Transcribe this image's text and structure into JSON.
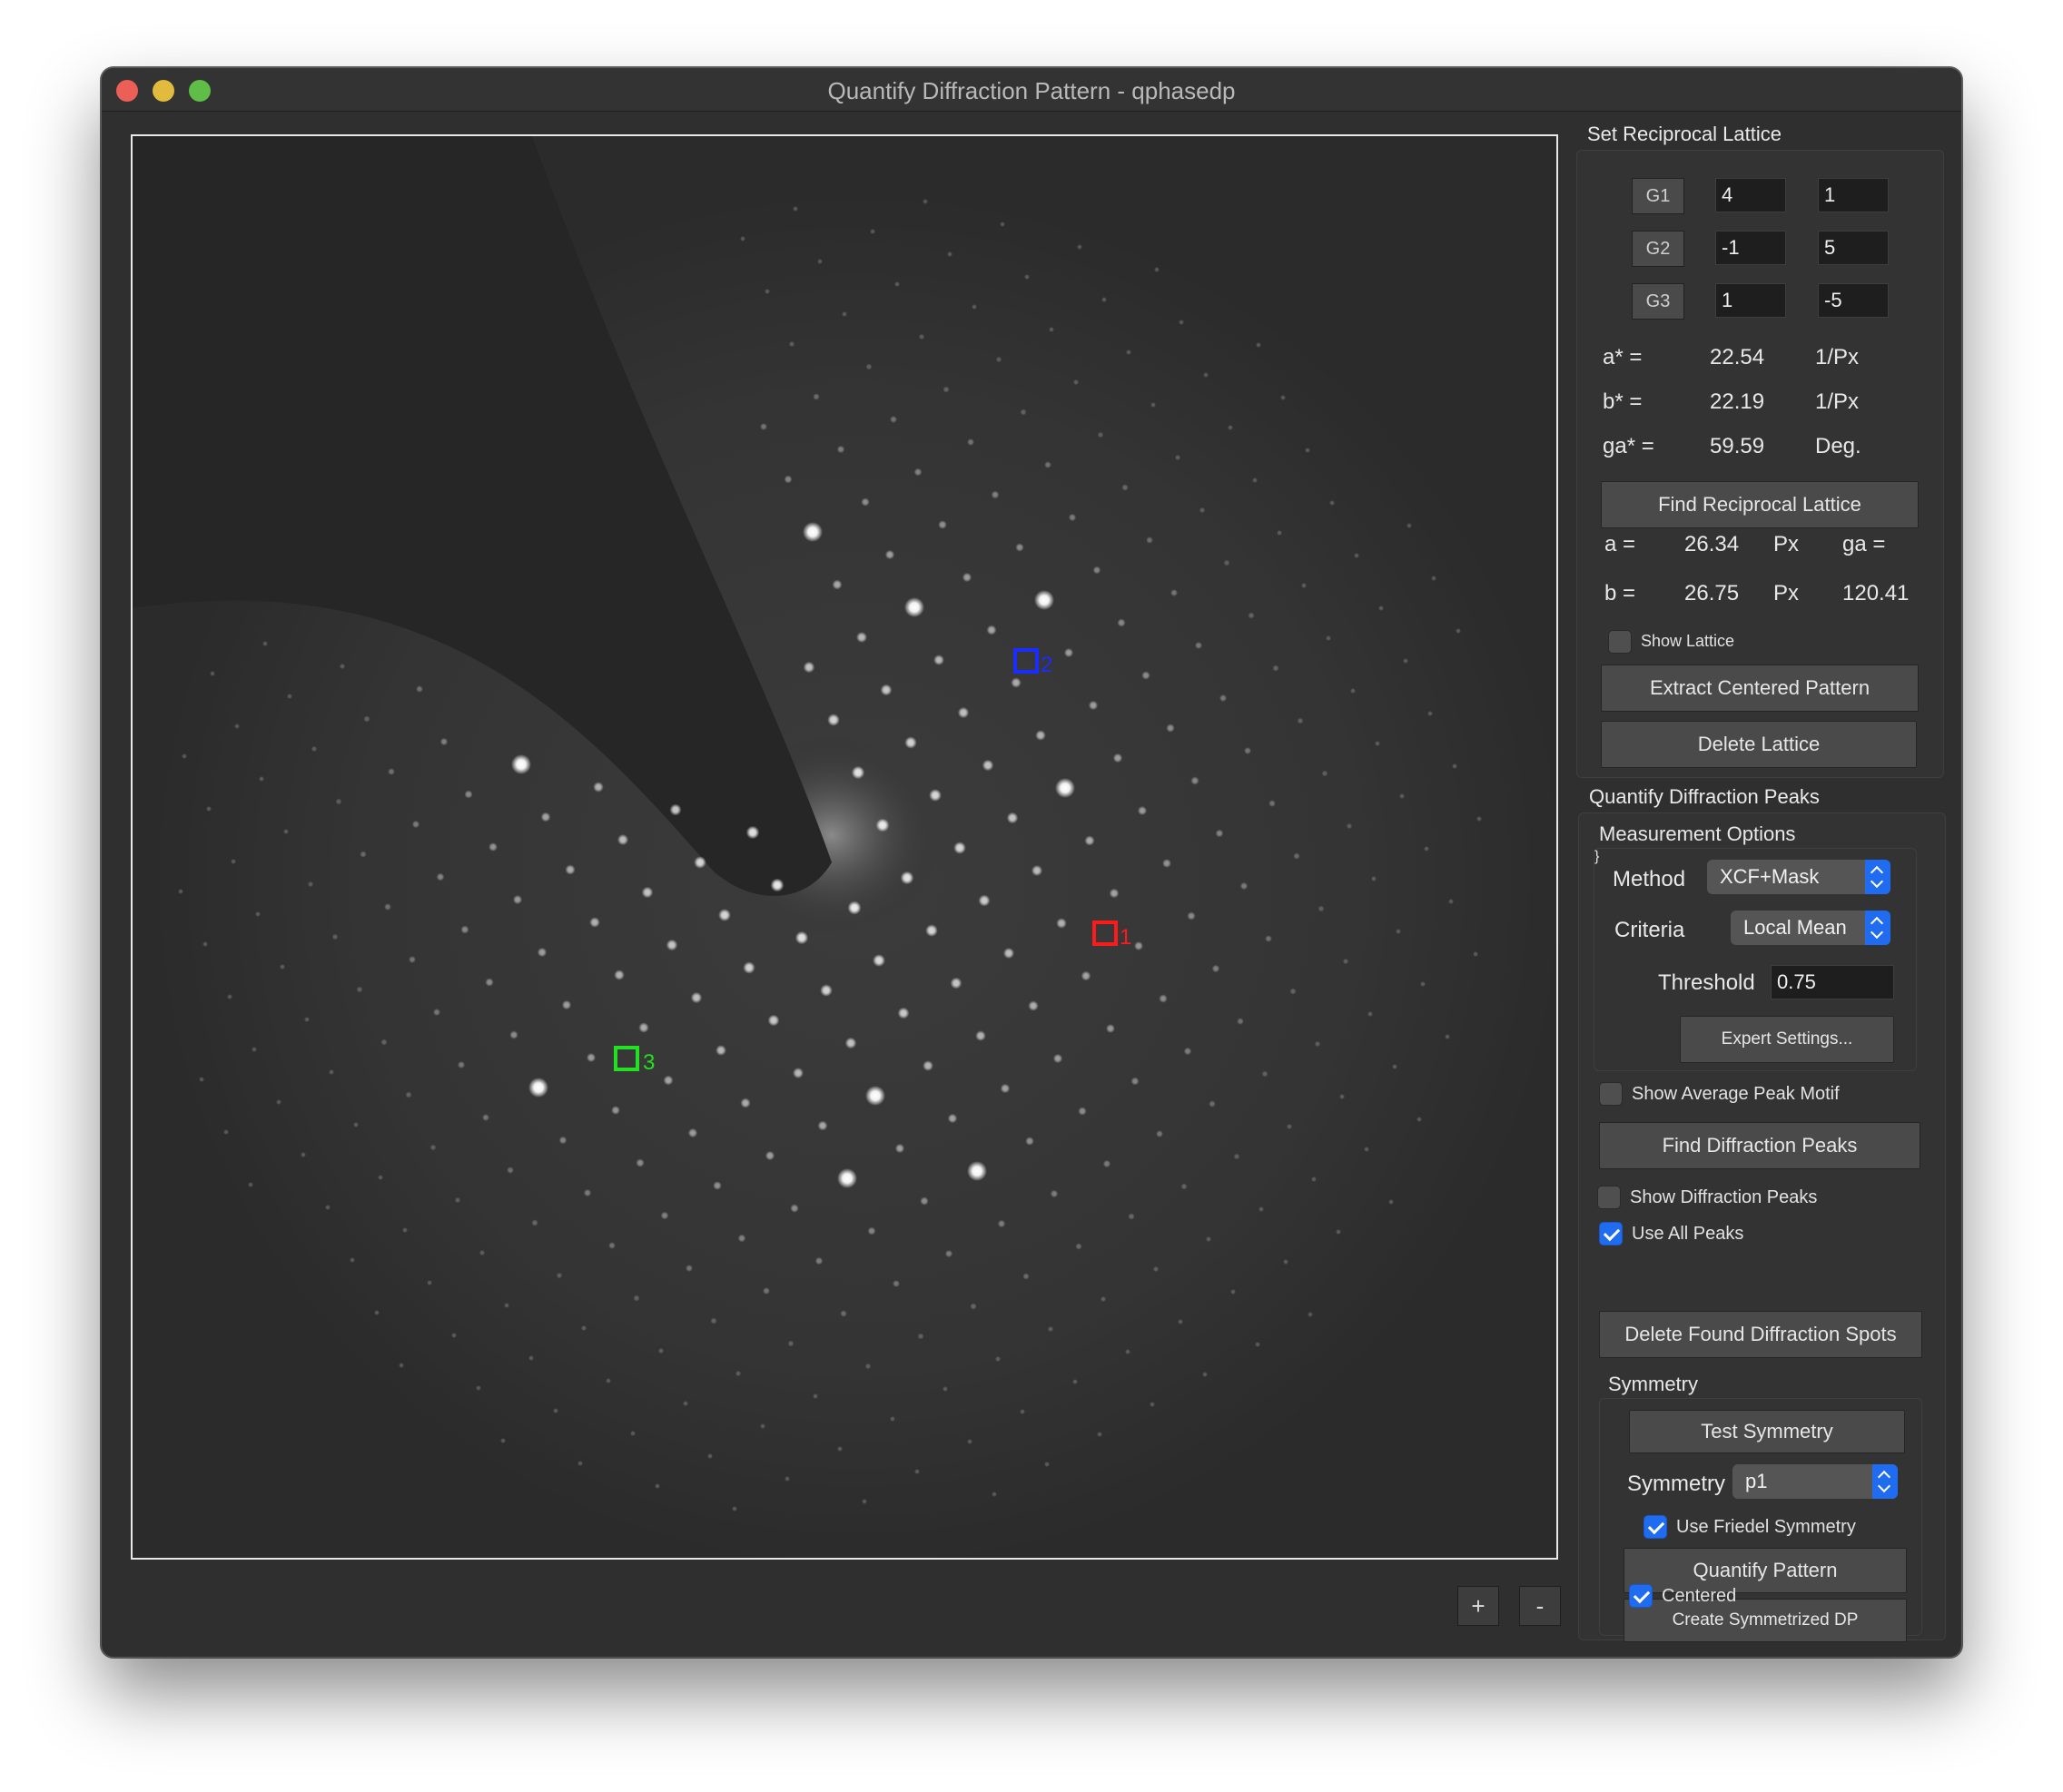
{
  "window": {
    "title": "Quantify Diffraction Pattern - qphasedp"
  },
  "canvas": {
    "markers": [
      {
        "label": "2",
        "color": "#1a2cff"
      },
      {
        "label": "1",
        "color": "#ff1a1a"
      },
      {
        "label": "3",
        "color": "#22e022"
      }
    ],
    "zoom_in": "+",
    "zoom_out": "-"
  },
  "reciprocal_lattice": {
    "title": "Set Reciprocal Lattice",
    "g_rows": [
      {
        "label": "G1",
        "v1": "4",
        "v2": "1"
      },
      {
        "label": "G2",
        "v1": "-1",
        "v2": "5"
      },
      {
        "label": "G3",
        "v1": "1",
        "v2": "-5"
      }
    ],
    "astar": {
      "label": "a* =",
      "value": "22.54",
      "unit": "1/Px"
    },
    "bstar": {
      "label": "b* =",
      "value": "22.19",
      "unit": "1/Px"
    },
    "gastar": {
      "label": "ga* =",
      "value": "59.59",
      "unit": "Deg."
    },
    "find_button": "Find Reciprocal Lattice",
    "a": {
      "label": "a =",
      "value": "26.34",
      "unit": "Px"
    },
    "b": {
      "label": "b =",
      "value": "26.75",
      "unit": "Px"
    },
    "ga": {
      "label": "ga =",
      "value": "120.41"
    },
    "show_lattice": "Show Lattice",
    "extract_button": "Extract Centered Pattern",
    "delete_button": "Delete Lattice"
  },
  "peaks": {
    "title": "Quantify Diffraction Peaks",
    "options_title": "Measurement Options",
    "method_label": "Method",
    "method_value": "XCF+Mask",
    "criteria_label": "Criteria",
    "criteria_value": "Local Mean",
    "threshold_label": "Threshold",
    "threshold_value": "0.75",
    "expert_button": "Expert Settings...",
    "show_motif": "Show Average Peak Motif",
    "find_button": "Find Diffraction Peaks",
    "show_peaks": "Show Diffraction Peaks",
    "use_all": "Use All Peaks",
    "delete_button": "Delete Found Diffraction Spots"
  },
  "symmetry": {
    "title": "Symmetry",
    "test_button": "Test Symmetry",
    "symmetry_label": "Symmetry",
    "symmetry_value": "p1",
    "friedel": "Use Friedel Symmetry",
    "quantify_button": "Quantify Pattern",
    "create_button": "Create Symmetrized DP",
    "centered": "Centered"
  },
  "colors": {
    "accent": "#1f6cf0",
    "window_bg": "#2f2f2f"
  }
}
